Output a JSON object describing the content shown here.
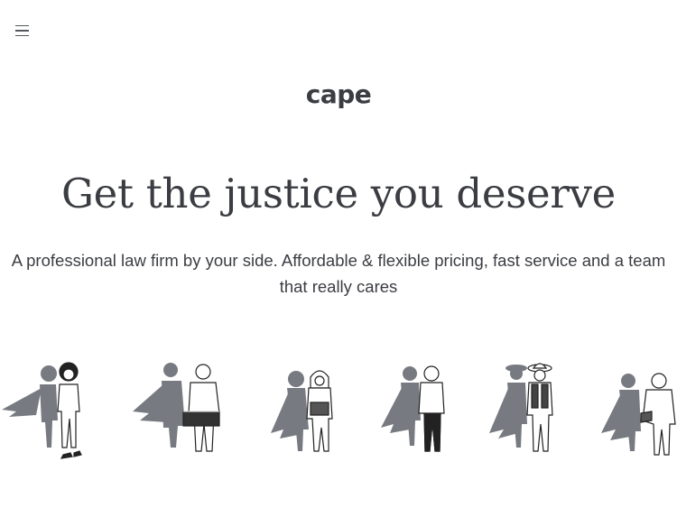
{
  "header": {
    "menu_icon": "hamburger-menu-icon",
    "logo_text": "cape"
  },
  "hero": {
    "title": "Get the justice you deserve",
    "subtitle_line1": "A professional law firm by your side. Affordable & flexible pricing, fast service and a team",
    "subtitle_line2": "that really cares"
  },
  "illustrations": [
    {
      "name": "woman-with-cape-shadow",
      "shadow_color": "#777a80"
    },
    {
      "name": "baker-with-cape-shadow",
      "shadow_color": "#777a80"
    },
    {
      "name": "hijab-woman-with-cape-shadow",
      "shadow_color": "#777a80"
    },
    {
      "name": "young-man-with-cape-shadow",
      "shadow_color": "#777a80"
    },
    {
      "name": "cowboy-woman-with-cape-shadow",
      "shadow_color": "#777a80"
    },
    {
      "name": "elderly-man-with-cape-shadow",
      "shadow_color": "#777a80"
    }
  ],
  "colors": {
    "text": "#3b3d42",
    "shadow": "#777a80",
    "background": "#ffffff"
  }
}
